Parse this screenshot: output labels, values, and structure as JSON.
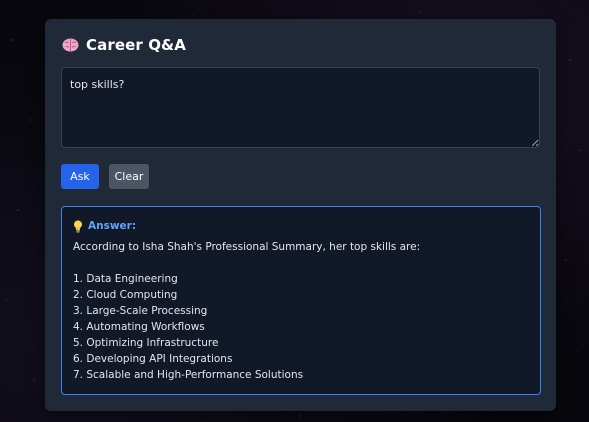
{
  "app": {
    "title": "Career Q&A",
    "title_icon": "brain-icon"
  },
  "question": {
    "value": "top skills?",
    "placeholder": ""
  },
  "buttons": {
    "ask_label": "Ask",
    "clear_label": "Clear"
  },
  "answer": {
    "icon": "lightbulb-icon",
    "label": "Answer:",
    "intro": "According to Isha Shah's Professional Summary, her top skills are:",
    "skills": [
      "1. Data Engineering",
      "2. Cloud Computing",
      "3. Large-Scale Processing",
      "4. Automating Workflows",
      "5. Optimizing Infrastructure",
      "6. Developing API Integrations",
      "7. Scalable and High-Performance Solutions"
    ]
  },
  "colors": {
    "page_background": "#07070d",
    "card_background": "#1f2937",
    "input_background": "#111827",
    "ask_button": "#2563eb",
    "clear_button": "#4b5563",
    "answer_border": "#3b82f6",
    "answer_label": "#60a5fa",
    "text": "#e5e7eb"
  }
}
